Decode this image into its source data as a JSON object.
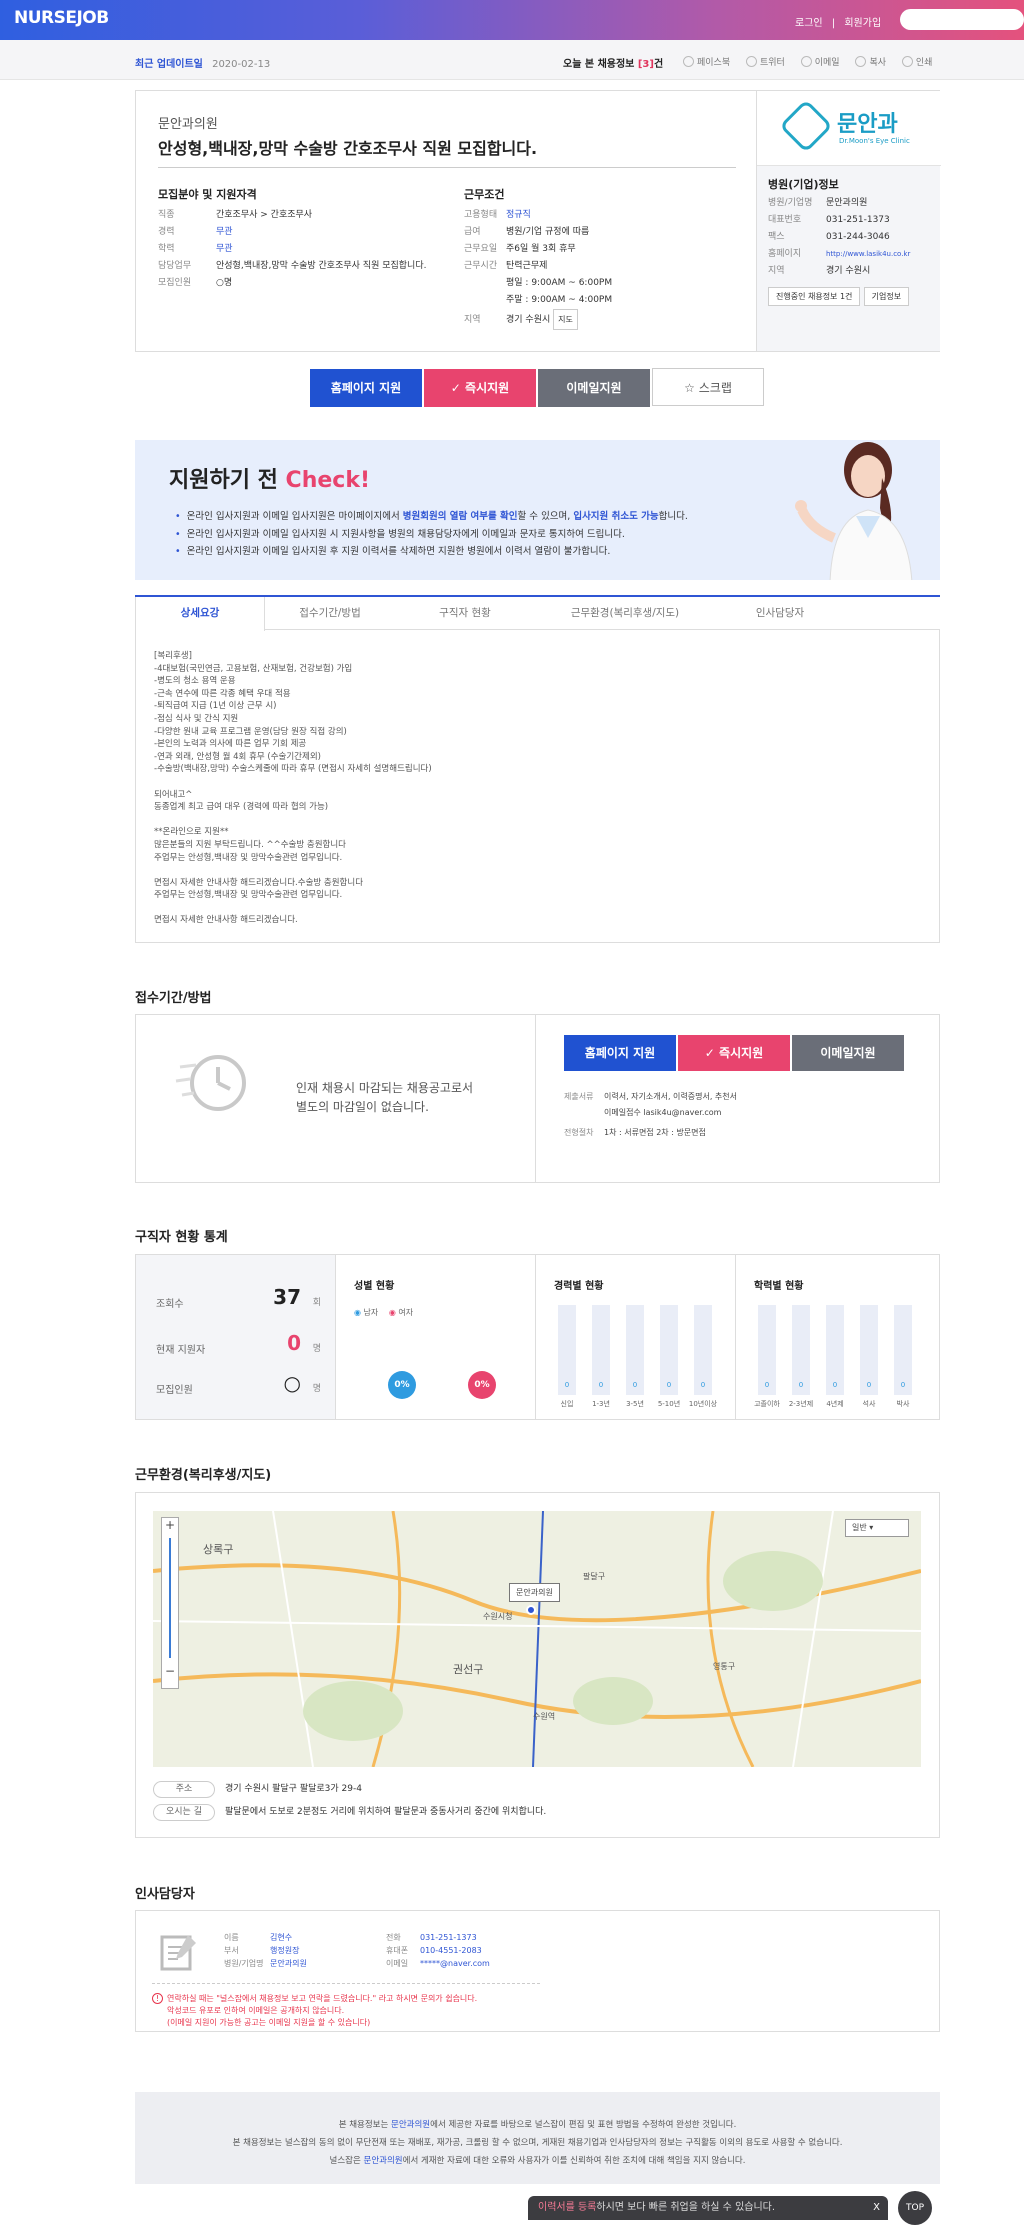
{
  "header": {
    "logo": "NURSEJOB",
    "login": "로그인",
    "signup": "회원가입",
    "search_placeholder": ""
  },
  "subbar": {
    "updated_label": "최근 업데이트일",
    "updated_date": "2020-02-13",
    "today_label": "오늘 본 채용정보",
    "today_count": "[3]",
    "today_unit": "건",
    "share": [
      "페이스북",
      "트위터",
      "이메일",
      "복사",
      "인쇄"
    ]
  },
  "job": {
    "company": "문안과의원",
    "title": "안성형,백내장,망막 수술방 간호조무사 직원 모집합니다.",
    "recruit_heading": "모집분야 및 지원자격",
    "recruit": [
      {
        "k": "직종",
        "v": "간호조무사 > 간호조무사"
      },
      {
        "k": "경력",
        "v": "무관"
      },
      {
        "k": "학력",
        "v": "무관"
      },
      {
        "k": "담당업무",
        "v": "안성형,백내장,망막 수술방 간호조무사 직원 모집합니다."
      },
      {
        "k": "모집인원",
        "v": "○명"
      }
    ],
    "cond_heading": "근무조건",
    "cond": [
      {
        "k": "고용형태",
        "v": "정규직"
      },
      {
        "k": "급여",
        "v": "병원/기업 규정에 따름"
      },
      {
        "k": "근무요일",
        "v": "주6일 월 3회 휴무"
      },
      {
        "k": "근무시간",
        "v": "탄력근무제"
      },
      {
        "k": "",
        "v": "평일 : 9:00AM ~ 6:00PM"
      },
      {
        "k": "",
        "v": "주말 : 9:00AM ~ 4:00PM"
      },
      {
        "k": "지역",
        "v": "경기 수원시"
      }
    ],
    "map_btn": "지도"
  },
  "hospital": {
    "logo_text": "문안과",
    "logo_sub": "Dr.Moon's Eye Clinic",
    "heading": "병원(기업)정보",
    "rows": [
      {
        "k": "병원/기업명",
        "v": "문안과의원"
      },
      {
        "k": "대표번호",
        "v": "031-251-1373"
      },
      {
        "k": "팩스",
        "v": "031-244-3046"
      },
      {
        "k": "홈페이지",
        "v": "http://www.lasik4u.co.kr"
      },
      {
        "k": "지역",
        "v": "경기 수원시"
      }
    ],
    "btn_ongoing": "진행중인 채용정보 1건",
    "btn_info": "기업정보"
  },
  "actions": {
    "home": "홈페이지 지원",
    "now": "즉시지원",
    "email": "이메일지원",
    "scrap": "스크랩"
  },
  "check": {
    "title_a": "지원하기 전",
    "title_b": "Check!",
    "items": [
      [
        "온라인 입사지원과 이메일 입사지원은 마이페이지에서 ",
        "병원회원의 열람 여부를 확인",
        "할 수 있으며, ",
        "입사지원 취소도 가능",
        "합니다."
      ],
      [
        "온라인 입사지원과 이메일 입사지원 시 지원사항을 병원의 채용담당자에게 이메일과 문자로 통지하여 드립니다."
      ],
      [
        "온라인 입사지원과 이메일 입사지원 후 지원 이력서를 삭제하면 지원한 병원에서 이력서 열람이 불가합니다."
      ]
    ]
  },
  "tabs": [
    "상세요강",
    "접수기간/방법",
    "구직자 현황",
    "근무환경(복리후생/지도)",
    "인사담당자"
  ],
  "detail_text": "[복리후생]\n-4대보험(국민연금, 고용보험, 산재보험, 건강보험) 가입\n-병도의 청소 용역 운용\n-근속 연수에 따른 각종 혜택 우대 적용\n-퇴직급여 지급 (1년 이상 근무 시)\n-점심 식사 및 간식 지원\n-다양한 원내 교육 프로그램 운영(담당 원장 직접 강의)\n-본인의 노력과 의사에 따른 업무 기회 제공\n-연과 외래, 안성형 월 4회 휴무 (수술기간제외)\n-수술방(백내장,망막) 수술스케줄에 따라 휴무 (면접시 자세히 설명해드립니다)\n\n되어내고^\n동종업계 최고 급여 대우 (경력에 따라 협의 가능)\n\n**온라인으로 지원**\n많은분들의 지원 부탁드립니다. ^^수술방 충원합니다\n주업무는 안성형,백내장 및 망막수술관련 업무입니다.\n\n면접시 자세한 안내사항 해드리겠습니다.수술방 충원합니다\n주업무는 안성형,백내장 및 망막수술관련 업무입니다.\n\n면접시 자세한 안내사항 해드리겠습니다.",
  "receipt": {
    "heading": "접수기간/방법",
    "text1": "인재 채용시 마감되는 채용공고로서",
    "text2": "별도의 마감일이 없습니다.",
    "rows": [
      {
        "k": "제출서류",
        "v": "이력서, 자기소개서, 이력증명서, 추천서"
      },
      {
        "k": "",
        "v": "이메일접수 lasik4u@naver.com"
      },
      {
        "k": "전형절차",
        "v": "1차 : 서류면접    2차 : 방문면접"
      }
    ]
  },
  "stats": {
    "heading": "구직자 현황 통계",
    "views_label": "조회수",
    "views": "37",
    "views_unit": "회",
    "applicants_label": "현재 지원자",
    "applicants": "0",
    "applicants_unit": "명",
    "recruit_label": "모집인원",
    "recruit": "○",
    "recruit_unit": "명",
    "gender_title": "성별 현황",
    "male": "남자",
    "female": "여자",
    "male_pct": "0%",
    "female_pct": "0%",
    "career_title": "경력별 현황",
    "career_labels": [
      "신입",
      "1-3년",
      "3-5년",
      "5-10년",
      "10년이상"
    ],
    "career_values": [
      0,
      0,
      0,
      0,
      0
    ],
    "edu_title": "학력별 현황",
    "edu_labels": [
      "고졸이하",
      "2-3년제",
      "4년제",
      "석사",
      "박사"
    ],
    "edu_values": [
      0,
      0,
      0,
      0,
      0
    ]
  },
  "env": {
    "heading": "근무환경(복리후생/지도)",
    "map_type": "일반",
    "marker": "문안과의원",
    "places": [
      "상록구",
      "권선구",
      "수원시청",
      "수원역",
      "팔달구",
      "영통구"
    ],
    "addr_label": "주소",
    "addr": "경기 수원시 팔달구 팔달로3가 29-4",
    "way_label": "오시는 길",
    "way": "팔달문에서 도보로 2분정도 거리에 위치하여 팔달문과 중동사거리 중간에 위치합니다."
  },
  "manager": {
    "heading": "인사담당자",
    "rows_left": [
      {
        "k": "이름",
        "v": "김현수"
      },
      {
        "k": "부서",
        "v": "행정원장"
      },
      {
        "k": "병원/기업명",
        "v": "문안과의원"
      }
    ],
    "rows_right": [
      {
        "k": "전화",
        "v": "031-251-1373"
      },
      {
        "k": "휴대폰",
        "v": "010-4551-2083"
      },
      {
        "k": "이메일",
        "v": "*****@naver.com"
      }
    ],
    "notice1": "연락하실 때는 \"널스잡에서 채용정보 보고 연락을 드렸습니다.\" 라고 하시면 문의가 쉽습니다.",
    "notice2": "악성코드 유포로 인하여 이메일은 공개하지 않습니다.",
    "notice3": "(이메일 지원이 가능한 공고는 이메일 지원을 할 수 있습니다)"
  },
  "footer": {
    "l1a": "본 채용정보는 ",
    "l1b": "문안과의원",
    "l1c": "에서 제공한 자료를 바탕으로 널스잡이 편집 및 표현 방법을 수정하여 완성한 것입니다.",
    "l2": "본 채용정보는 널스잡의 동의 없이 무단전재 또는 재배포, 재가공, 크롤링 할 수 없으며, 게재된 채용기업과 인사담당자의 정보는 구직활동 이외의 용도로 사용할 수 없습니다.",
    "l3a": "널스잡은 ",
    "l3b": "문안과의원",
    "l3c": "에서 게재한 자료에 대한 오류와 사용자가 이를 신뢰하여 취한 조치에 대해 책임을 지지 않습니다."
  },
  "banner": {
    "a": "이력서를 등록",
    "b": "하시면 보다 빠른 취업을 하실 수 있습니다.",
    "x": "X",
    "top": "TOP"
  }
}
